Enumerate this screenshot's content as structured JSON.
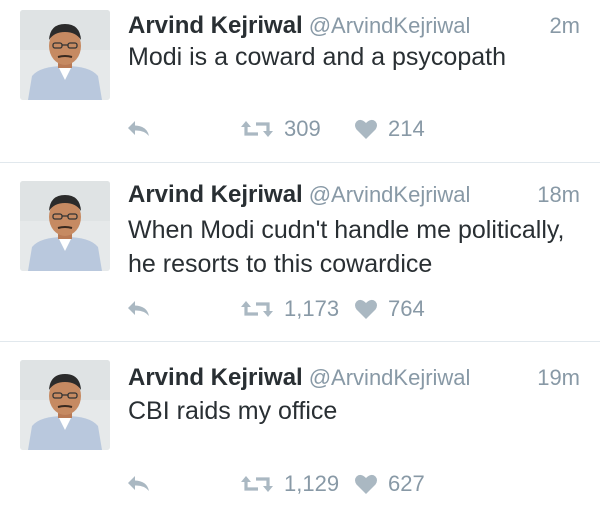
{
  "tweets": [
    {
      "name": "Arvind Kejriwal",
      "handle": "@ArvindKejriwal",
      "time": "2m",
      "text": "Modi is a coward and a psycopath",
      "retweets": "309",
      "likes": "214"
    },
    {
      "name": "Arvind Kejriwal",
      "handle": "@ArvindKejriwal",
      "time": "18m",
      "text": "When Modi cudn't handle me politically, he resorts to this cowardice",
      "retweets": "1,173",
      "likes": "764"
    },
    {
      "name": "Arvind Kejriwal",
      "handle": "@ArvindKejriwal",
      "time": "19m",
      "text": "CBI raids my office",
      "retweets": "1,129",
      "likes": "627"
    }
  ],
  "icons": {
    "reply": "reply-icon",
    "retweet": "retweet-icon",
    "like": "heart-icon"
  },
  "colors": {
    "name": "#292f33",
    "meta": "#8899a6",
    "divider": "#e1e8ed"
  }
}
